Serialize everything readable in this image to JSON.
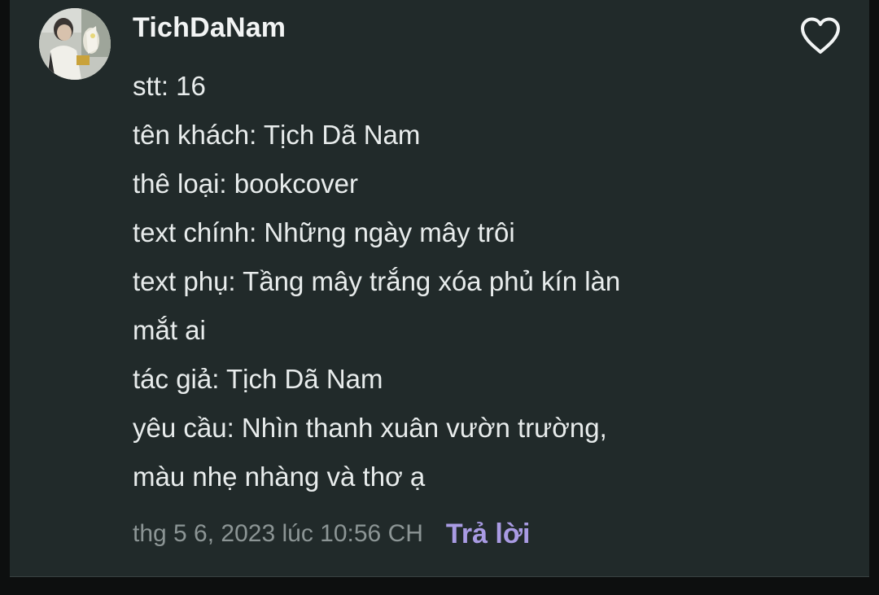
{
  "comment": {
    "author": "TichDaNam",
    "lines": [
      "stt: 16",
      "tên khách: Tịch Dã Nam",
      "thê loại: bookcover",
      "text chính: Những ngày mây trôi",
      "text phụ: Tầng mây trắng xóa phủ kín làn",
      "mắt ai",
      "tác giả: Tịch Dã Nam",
      "yêu cầu: Nhìn thanh xuân vườn trường,",
      "màu nhẹ nhàng và thơ ạ"
    ],
    "timestamp": "thg 5 6, 2023 lúc 10:56 CH",
    "reply_label": "Trả lời"
  },
  "colors": {
    "card_background": "#212a2a",
    "text": "#e8ecec",
    "timestamp": "#8c9595",
    "reply_accent": "#a99be3"
  },
  "icons": {
    "like": "heart-outline-icon",
    "avatar": "user-avatar-photo"
  }
}
